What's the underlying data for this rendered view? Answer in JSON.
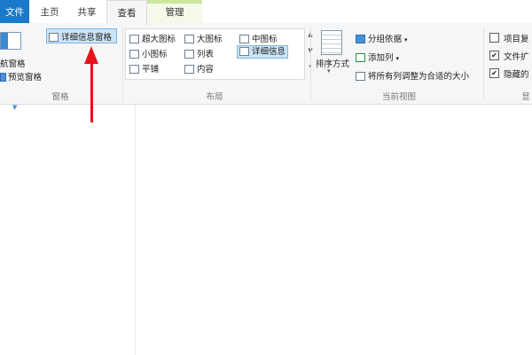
{
  "tabs": {
    "file": "文件",
    "home": "主页",
    "share": "共享",
    "view": "查看",
    "manage": "管理"
  },
  "pane_group": {
    "nav_pane": "航窗格",
    "preview_pane": "预览窗格",
    "details_pane": "详细信息窗格",
    "label": "窗格"
  },
  "layout_group": {
    "extra_large_icons": "超大图标",
    "large_icons": "大图标",
    "medium_icons": "中图标",
    "small_icons": "小图标",
    "list": "列表",
    "details": "详细信息",
    "tiles": "平铺",
    "content": "内容",
    "label": "布局"
  },
  "current_view_group": {
    "sort_by": "排序方式",
    "group_by": "分组依据",
    "add_columns": "添加列",
    "size_all_columns": "将所有列调整为合适的大小",
    "label": "当前视图"
  },
  "show_hide_group": {
    "item_checkboxes": "项目复",
    "file_extensions": "文件扩",
    "hidden_items": "隐藏的",
    "label": "显"
  },
  "colors": {
    "file_tab": "#1979ca",
    "selection": "#cce4f7",
    "arrow": "#e8131b"
  }
}
